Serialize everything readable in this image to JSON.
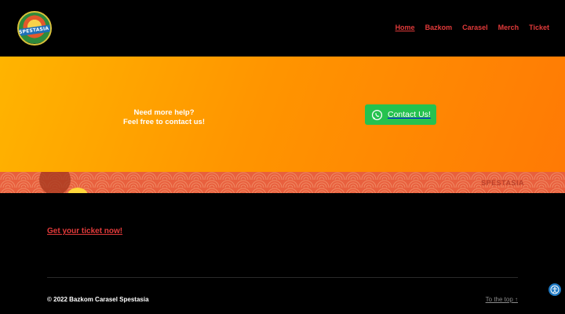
{
  "header": {
    "logo_text": "SPESTASIA",
    "nav": [
      {
        "label": "Home",
        "active": true
      },
      {
        "label": "Bazkom",
        "active": false
      },
      {
        "label": "Carasel",
        "active": false
      },
      {
        "label": "Merch",
        "active": false
      },
      {
        "label": "Ticket",
        "active": false
      }
    ]
  },
  "help": {
    "line1": "Need more help?",
    "line2": "Feel free to contact us!",
    "contact_button": "Contact Us!",
    "contact_icon": "whatsapp-icon"
  },
  "banner": {
    "logo_text": "SPESTASIA"
  },
  "footer": {
    "ticket_link": "Get your ticket now!",
    "copyright": "© 2022 Bazkom Carasel Spestasia",
    "to_top": "To the top ↑",
    "accessibility_icon": "accessibility-icon"
  },
  "colors": {
    "accent_red": "#e23a3a",
    "whatsapp_green": "#25c24f",
    "orange_start": "#ffb400",
    "orange_end": "#ff7a05"
  }
}
